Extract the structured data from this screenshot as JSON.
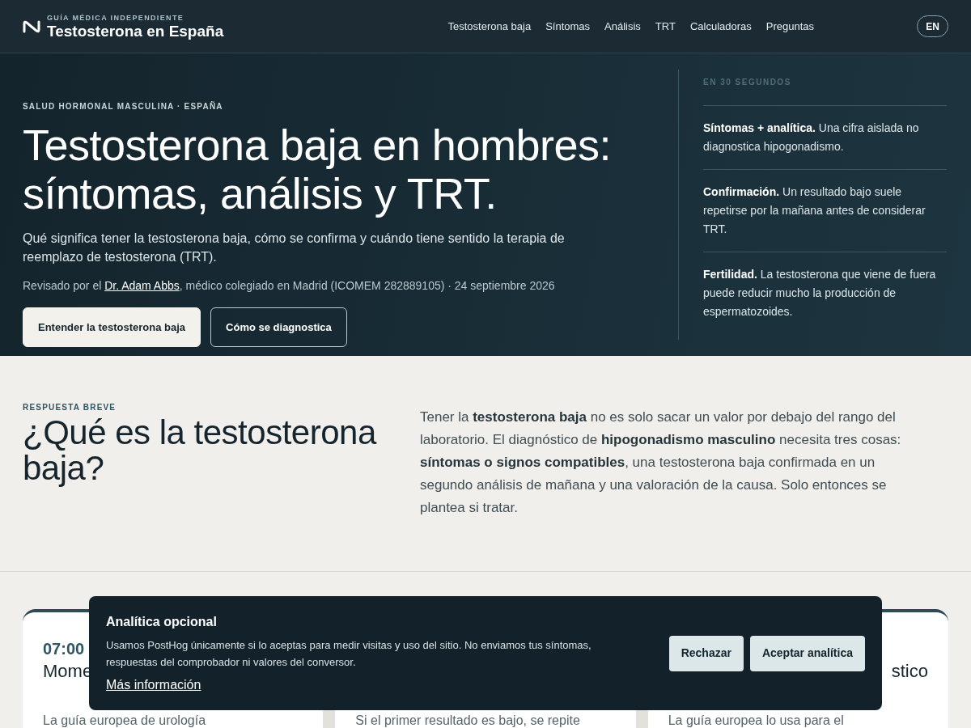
{
  "header": {
    "brand_kicker": "GUÍA MÉDICA INDEPENDIENTE",
    "brand_name": "Testosterona en España",
    "nav": [
      "Testosterona baja",
      "Síntomas",
      "Análisis",
      "TRT",
      "Calculadoras",
      "Preguntas"
    ],
    "language_button": "EN"
  },
  "hero": {
    "eyebrow": "SALUD HORMONAL MASCULINA · ESPAÑA",
    "title": "Testosterona baja en hombres: síntomas, análisis y TRT.",
    "lead": "Qué significa tener la testosterona baja, cómo se confirma y cuándo tiene sentido la terapia de reemplazo de testosterona (TRT).",
    "review_prefix": "Revisado por el",
    "reviewer_link": "Dr. Adam Abbs",
    "review_suffix": ", médico colegiado en Madrid (ICOMEM 282889105) · 24 septiembre 2026",
    "buttons": [
      {
        "label": "Entender la testosterona baja",
        "kind": "primary"
      },
      {
        "label": "Cómo se diagnostica",
        "kind": "outline"
      }
    ],
    "summary": {
      "title": "EN 30 SEGUNDOS",
      "items": [
        {
          "text": "**Síntomas + analítica.** Una cifra aislada no diagnostica hipogonadismo."
        },
        {
          "text": "**Confirmación.** Un resultado bajo suele repetirse por la mañana antes de considerar TRT."
        },
        {
          "text": "**Fertilidad.** La testosterona que viene de fuera puede reducir mucho la producción de espermatozoides."
        }
      ]
    }
  },
  "answer": {
    "eyebrow": "RESPUESTA BREVE",
    "title": "¿Qué es la testosterona baja?",
    "body": "Tener la **testosterona baja** no es solo sacar un valor por debajo del rango del laboratorio. El diagnóstico de **hipogonadismo masculino** necesita tres cosas: **síntomas o signos compatibles**, una testosterona baja confirmada en un segundo análisis de mañana y una valoración de la causa. Solo entonces se plantea si tratar."
  },
  "cards": [
    {
      "time": "07:00",
      "heading": "Mome",
      "text": "La guía europea de urología"
    },
    {
      "text": "Si el primer resultado es bajo, se repite"
    },
    {
      "heading": "stico",
      "text": "La guía europea lo usa para el"
    }
  ],
  "cookie_banner": {
    "title": "Analítica opcional",
    "text": "Usamos PostHog únicamente si lo aceptas para medir visitas y uso del sitio. No enviamos tus síntomas, respuestas del comprobador ni valores del conversor.",
    "link": "Más información",
    "buttons": [
      "Rechazar",
      "Aceptar analítica"
    ]
  }
}
